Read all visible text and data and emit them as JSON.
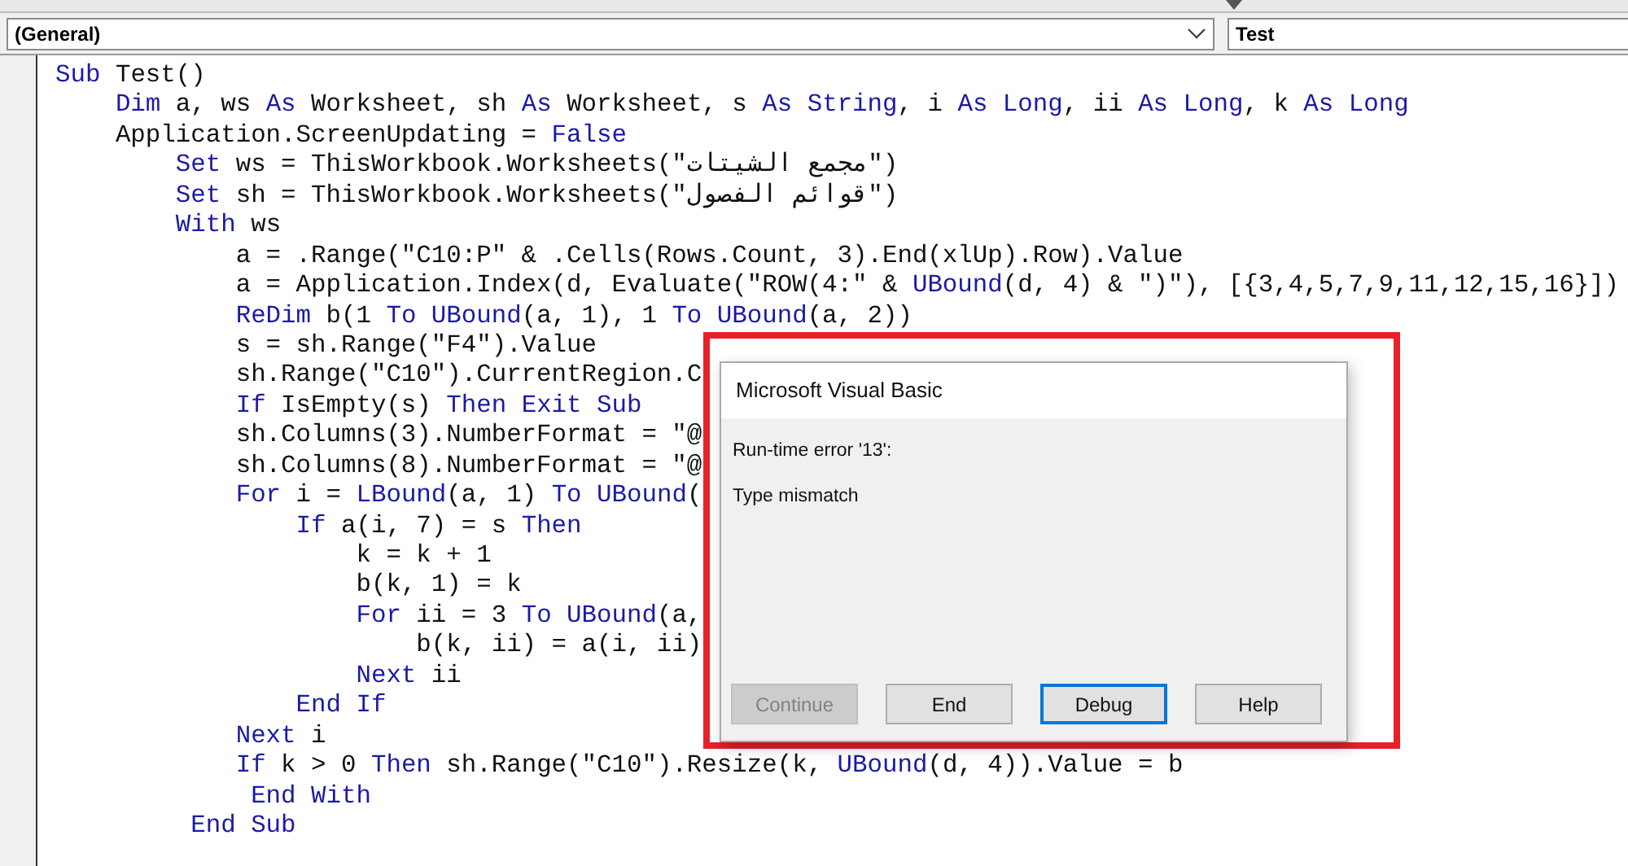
{
  "procedure_bar": {
    "object_combo": "(General)",
    "procedure_combo": "Test"
  },
  "code_lines": [
    [
      {
        "kind": "kw",
        "text": "Sub"
      },
      {
        "kind": "plain",
        "text": " Test()"
      }
    ],
    [
      {
        "kind": "kw",
        "text": "    Dim"
      },
      {
        "kind": "plain",
        "text": " a, ws "
      },
      {
        "kind": "kw",
        "text": "As"
      },
      {
        "kind": "plain",
        "text": " Worksheet, sh "
      },
      {
        "kind": "kw",
        "text": "As"
      },
      {
        "kind": "plain",
        "text": " Worksheet, s "
      },
      {
        "kind": "kw",
        "text": "As String"
      },
      {
        "kind": "plain",
        "text": ", i "
      },
      {
        "kind": "kw",
        "text": "As Long"
      },
      {
        "kind": "plain",
        "text": ", ii "
      },
      {
        "kind": "kw",
        "text": "As Long"
      },
      {
        "kind": "plain",
        "text": ", k "
      },
      {
        "kind": "kw",
        "text": "As Long"
      }
    ],
    [
      {
        "kind": "plain",
        "text": "    Application.ScreenUpdating = "
      },
      {
        "kind": "kw",
        "text": "False"
      }
    ],
    [
      {
        "kind": "kw",
        "text": "        Set"
      },
      {
        "kind": "plain",
        "text": " ws = ThisWorkbook.Worksheets(\"مجمع الشيتات\")"
      }
    ],
    [
      {
        "kind": "kw",
        "text": "        Set"
      },
      {
        "kind": "plain",
        "text": " sh = ThisWorkbook.Worksheets(\"قوائم الفصول\")"
      }
    ],
    [
      {
        "kind": "kw",
        "text": "        With"
      },
      {
        "kind": "plain",
        "text": " ws"
      }
    ],
    [
      {
        "kind": "plain",
        "text": "            a = .Range(\"C10:P\" & .Cells(Rows.Count, 3).End(xlUp).Row).Value"
      }
    ],
    [
      {
        "kind": "plain",
        "text": "            a = Application.Index(d, Evaluate(\"ROW(4:\" & "
      },
      {
        "kind": "kw",
        "text": "UBound"
      },
      {
        "kind": "plain",
        "text": "(d, 4) & \")\"), [{3,4,5,7,9,11,12,15,16}])"
      }
    ],
    [
      {
        "kind": "kw",
        "text": "            ReDim"
      },
      {
        "kind": "plain",
        "text": " b(1 "
      },
      {
        "kind": "kw",
        "text": "To UBound"
      },
      {
        "kind": "plain",
        "text": "(a, 1), 1 "
      },
      {
        "kind": "kw",
        "text": "To UBound"
      },
      {
        "kind": "plain",
        "text": "(a, 2))"
      }
    ],
    [
      {
        "kind": "plain",
        "text": "            s = sh.Range(\"F4\").Value"
      }
    ],
    [
      {
        "kind": "plain",
        "text": "            sh.Range(\"C10\").CurrentRegion.C"
      }
    ],
    [
      {
        "kind": "kw",
        "text": "            If"
      },
      {
        "kind": "plain",
        "text": " IsEmpty(s) "
      },
      {
        "kind": "kw",
        "text": "Then Exit Sub"
      }
    ],
    [
      {
        "kind": "plain",
        "text": "            sh.Columns(3).NumberFormat = \"@"
      }
    ],
    [
      {
        "kind": "plain",
        "text": "            sh.Columns(8).NumberFormat = \"@"
      }
    ],
    [
      {
        "kind": "kw",
        "text": "            For"
      },
      {
        "kind": "plain",
        "text": " i = "
      },
      {
        "kind": "kw",
        "text": "LBound"
      },
      {
        "kind": "plain",
        "text": "(a, 1) "
      },
      {
        "kind": "kw",
        "text": "To UBound"
      },
      {
        "kind": "plain",
        "text": "("
      }
    ],
    [
      {
        "kind": "kw",
        "text": "                If"
      },
      {
        "kind": "plain",
        "text": " a(i, 7) = s "
      },
      {
        "kind": "kw",
        "text": "Then"
      }
    ],
    [
      {
        "kind": "plain",
        "text": "                    k = k + 1"
      }
    ],
    [
      {
        "kind": "plain",
        "text": "                    b(k, 1) = k"
      }
    ],
    [
      {
        "kind": "kw",
        "text": "                    For"
      },
      {
        "kind": "plain",
        "text": " ii = 3 "
      },
      {
        "kind": "kw",
        "text": "To UBound"
      },
      {
        "kind": "plain",
        "text": "(a,"
      }
    ],
    [
      {
        "kind": "plain",
        "text": "                        b(k, ii) = a(i, ii)"
      }
    ],
    [
      {
        "kind": "kw",
        "text": "                    Next"
      },
      {
        "kind": "plain",
        "text": " ii"
      }
    ],
    [
      {
        "kind": "kw",
        "text": "                End If"
      }
    ],
    [
      {
        "kind": "kw",
        "text": "            Next"
      },
      {
        "kind": "plain",
        "text": " i"
      }
    ],
    [
      {
        "kind": "kw",
        "text": "            If"
      },
      {
        "kind": "plain",
        "text": " k > 0 "
      },
      {
        "kind": "kw",
        "text": "Then"
      },
      {
        "kind": "plain",
        "text": " sh.Range(\"C10\").Resize(k, "
      },
      {
        "kind": "kw",
        "text": "UBound"
      },
      {
        "kind": "plain",
        "text": "(d, 4)).Value = b"
      }
    ],
    [
      {
        "kind": "kw",
        "text": "             End With"
      }
    ],
    [
      {
        "kind": "kw",
        "text": "         End Sub"
      }
    ]
  ],
  "dialog": {
    "title": "Microsoft Visual Basic",
    "error": "Run-time error '13':",
    "message": "Type mismatch",
    "buttons": [
      {
        "label": "Continue",
        "disabled": true,
        "focused": false
      },
      {
        "label": "End",
        "disabled": false,
        "focused": false
      },
      {
        "label": "Debug",
        "disabled": false,
        "focused": true
      },
      {
        "label": "Help",
        "disabled": false,
        "focused": false
      }
    ]
  }
}
